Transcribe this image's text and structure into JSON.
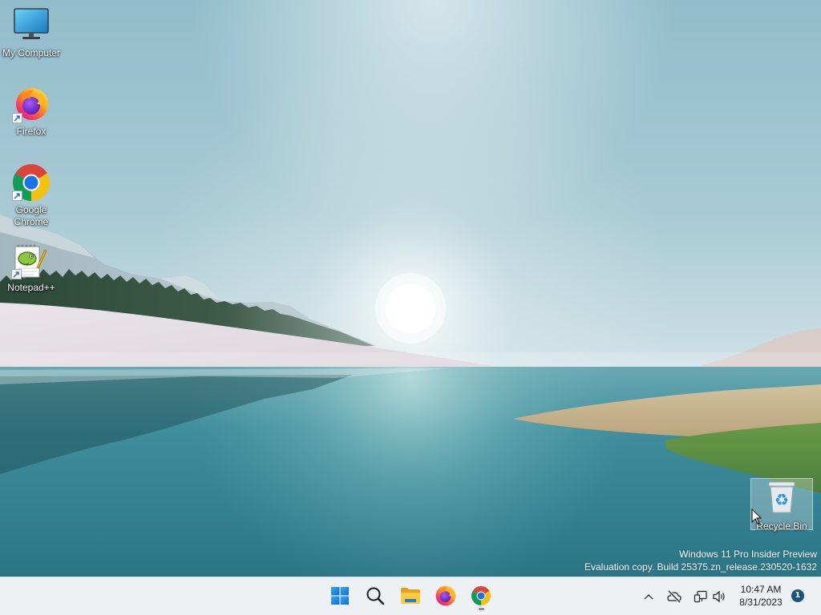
{
  "desktop": {
    "icons": [
      {
        "label": "My Computer",
        "icon": "computer-icon"
      },
      {
        "label": "Firefox",
        "icon": "firefox-icon",
        "shortcut": true
      },
      {
        "label": "Google Chrome",
        "icon": "chrome-icon",
        "shortcut": true
      },
      {
        "label": "Notepad++",
        "icon": "notepad-plus-plus-icon",
        "shortcut": true
      }
    ],
    "recycle_bin": {
      "label": "Recycle Bin",
      "icon": "recycle-bin-icon",
      "highlighted": true
    }
  },
  "watermark": {
    "line1": "Windows 11 Pro Insider Preview",
    "line2": "Evaluation copy. Build 25375.zn_release.230520-1632"
  },
  "taskbar": {
    "pinned": [
      {
        "icon": "windows-start-icon"
      },
      {
        "icon": "search-icon"
      },
      {
        "icon": "file-explorer-icon"
      },
      {
        "icon": "firefox-icon"
      },
      {
        "icon": "chrome-icon",
        "running": true
      }
    ],
    "tray": {
      "icons": [
        "chevron-up-icon",
        "cloud-offline-icon",
        "network-icon",
        "volume-icon"
      ],
      "time": "10:47 AM",
      "date": "8/31/2023",
      "notification_count": "1"
    }
  },
  "colors": {
    "taskbar_bg": "#eef1f4",
    "start_blue": "#0a6fd6",
    "badge": "#17527f",
    "label_text": "#ffffff"
  }
}
